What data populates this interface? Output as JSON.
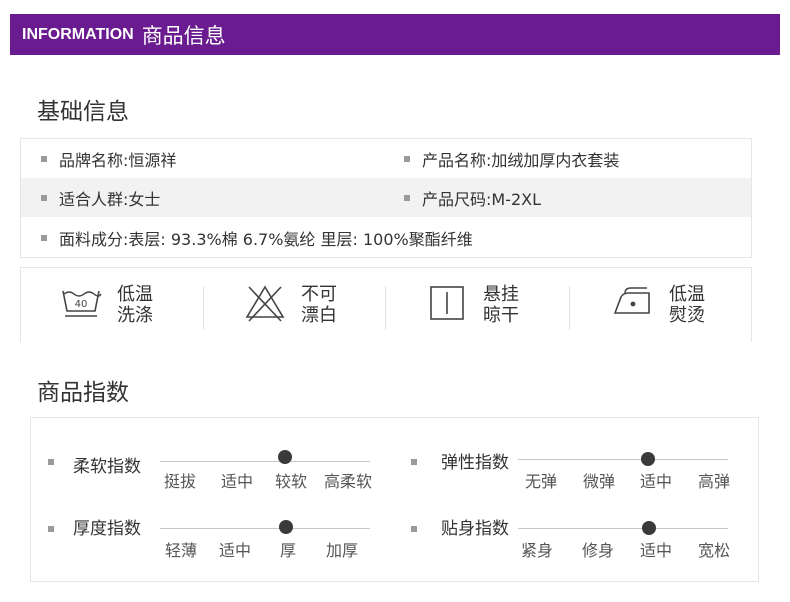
{
  "header": {
    "en": "INFORMATION",
    "zh": "商品信息"
  },
  "basic": {
    "title": "基础信息",
    "brand": "品牌名称:恒源祥",
    "product": "产品名称:加绒加厚内衣套装",
    "people": "适合人群:女士",
    "size": "产品尺码:M-2XL",
    "material": "面料成分:表层: 93.3%棉 6.7%氨纶 里层: 100%聚酯纤维"
  },
  "care": [
    {
      "icon": "wash-40-icon",
      "line1": "低温",
      "line2": "洗涤",
      "temp": "40"
    },
    {
      "icon": "no-bleach-icon",
      "line1": "不可",
      "line2": "漂白"
    },
    {
      "icon": "hang-dry-icon",
      "line1": "悬挂",
      "line2": "晾干"
    },
    {
      "icon": "low-iron-icon",
      "line1": "低温",
      "line2": "熨烫"
    }
  ],
  "index": {
    "title": "商品指数",
    "items": [
      {
        "name": "柔软指数",
        "levels": [
          "挺拔",
          "适中",
          "较软",
          "高柔软"
        ],
        "selected": 2
      },
      {
        "name": "弹性指数",
        "levels": [
          "无弹",
          "微弹",
          "适中",
          "高弹"
        ],
        "selected": 2
      },
      {
        "name": "厚度指数",
        "levels": [
          "轻薄",
          "适中",
          "厚",
          "加厚"
        ],
        "selected": 2
      },
      {
        "name": "贴身指数",
        "levels": [
          "紧身",
          "修身",
          "适中",
          "宽松"
        ],
        "selected": 2
      }
    ]
  },
  "colors": {
    "header_bg": "#6a1b8f",
    "dot": "#3a3a3a"
  }
}
